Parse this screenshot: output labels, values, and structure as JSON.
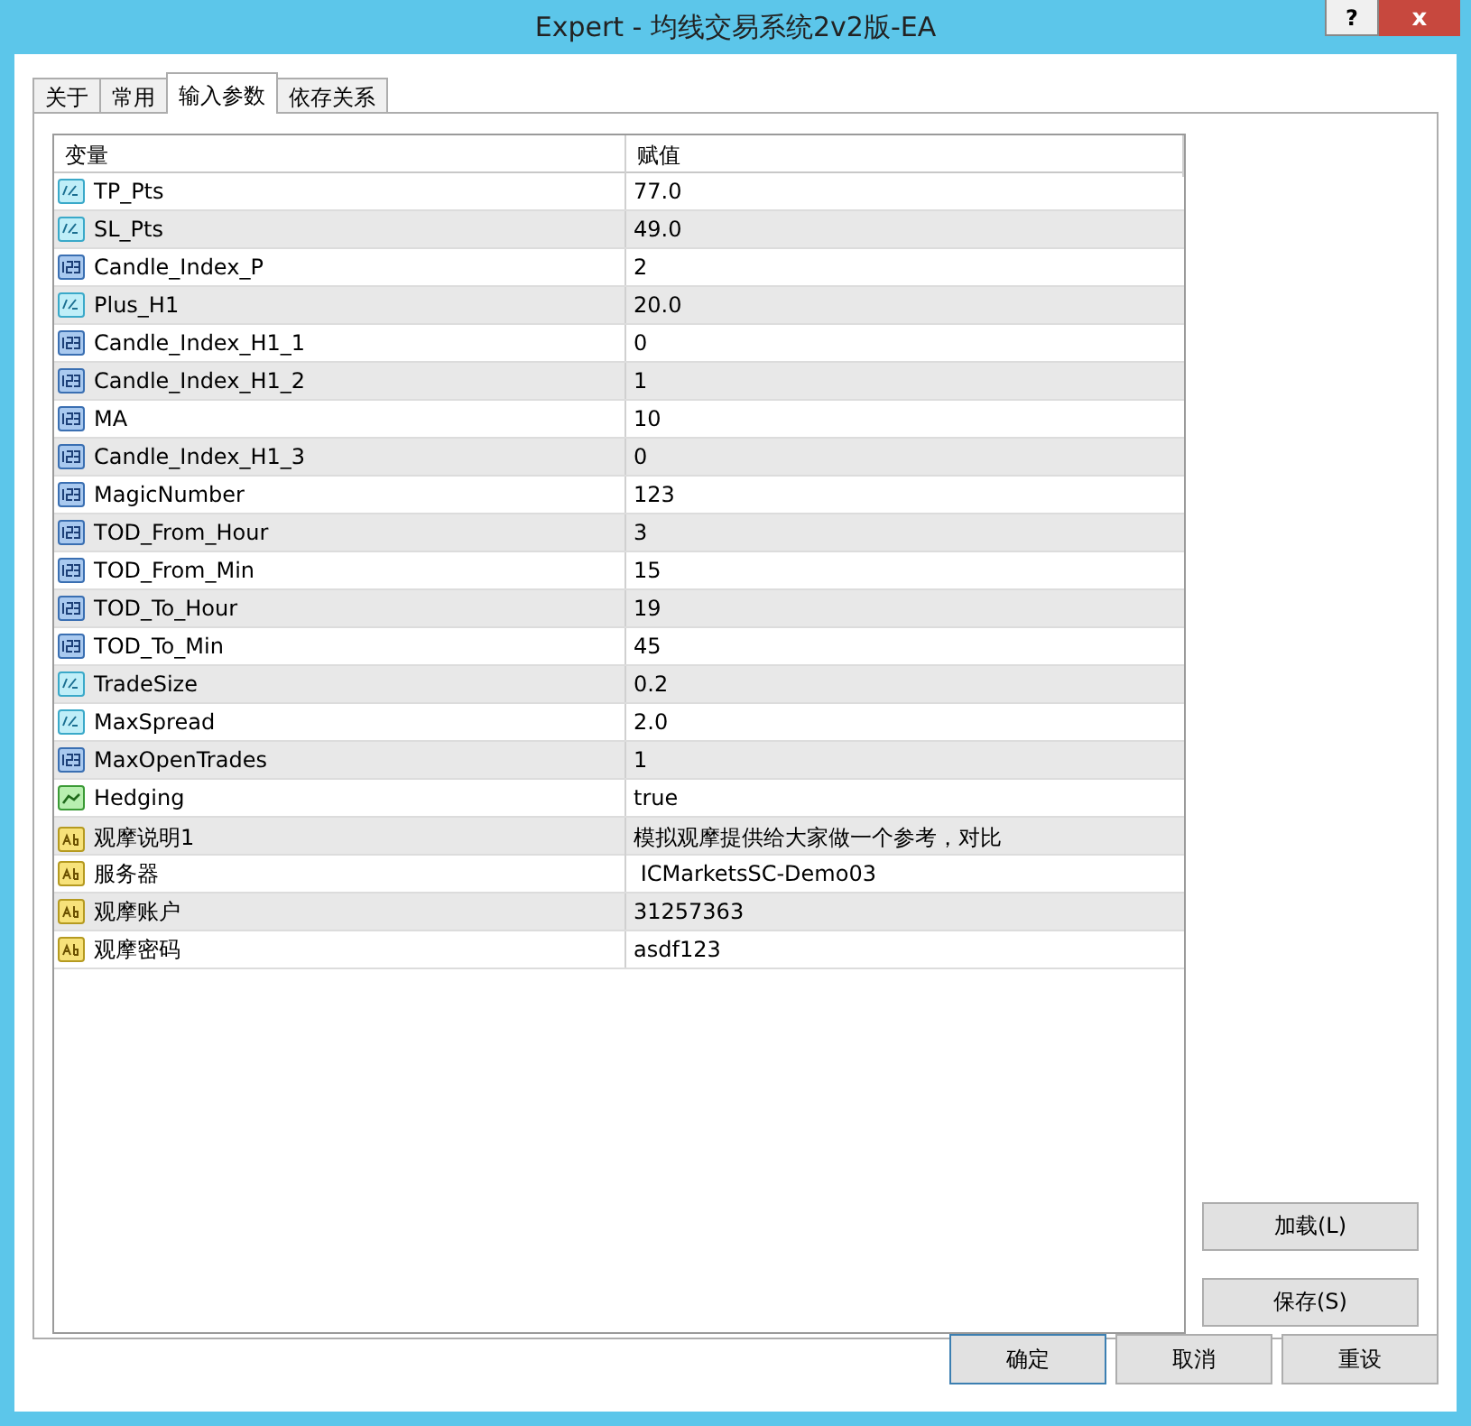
{
  "window": {
    "title": "Expert - 均线交易系统2v2版-EA",
    "help_button": "?",
    "close_button": "x"
  },
  "tabs": [
    {
      "label": "关于",
      "selected": false
    },
    {
      "label": "常用",
      "selected": false
    },
    {
      "label": "输入参数",
      "selected": true
    },
    {
      "label": "依存关系",
      "selected": false
    }
  ],
  "table": {
    "columns": [
      "变量",
      "赋值"
    ],
    "rows": [
      {
        "kind": "double",
        "name": "TP_Pts",
        "value": "77.0"
      },
      {
        "kind": "double",
        "name": "SL_Pts",
        "value": "49.0"
      },
      {
        "kind": "int",
        "name": "Candle_Index_P",
        "value": "2"
      },
      {
        "kind": "double",
        "name": "Plus_H1",
        "value": "20.0"
      },
      {
        "kind": "int",
        "name": "Candle_Index_H1_1",
        "value": "0"
      },
      {
        "kind": "int",
        "name": "Candle_Index_H1_2",
        "value": "1"
      },
      {
        "kind": "int",
        "name": "MA",
        "value": "10"
      },
      {
        "kind": "int",
        "name": "Candle_Index_H1_3",
        "value": "0"
      },
      {
        "kind": "int",
        "name": "MagicNumber",
        "value": "123"
      },
      {
        "kind": "int",
        "name": "TOD_From_Hour",
        "value": "3"
      },
      {
        "kind": "int",
        "name": "TOD_From_Min",
        "value": "15"
      },
      {
        "kind": "int",
        "name": "TOD_To_Hour",
        "value": "19"
      },
      {
        "kind": "int",
        "name": "TOD_To_Min",
        "value": "45"
      },
      {
        "kind": "double",
        "name": "TradeSize",
        "value": "0.2"
      },
      {
        "kind": "double",
        "name": "MaxSpread",
        "value": "2.0"
      },
      {
        "kind": "int",
        "name": "MaxOpenTrades",
        "value": "1"
      },
      {
        "kind": "bool",
        "name": "Hedging",
        "value": "true"
      },
      {
        "kind": "string",
        "name": "观摩说明1",
        "value": "模拟观摩提供给大家做一个参考，对比"
      },
      {
        "kind": "string",
        "name": "服务器",
        "value": " ICMarketsSC-Demo03"
      },
      {
        "kind": "string",
        "name": "观摩账户",
        "value": "31257363"
      },
      {
        "kind": "string",
        "name": "观摩密码",
        "value": "asdf123"
      }
    ]
  },
  "side_buttons": [
    "加载(L)",
    "保存(S)"
  ],
  "buttons": [
    {
      "label": "确定",
      "default": true
    },
    {
      "label": "取消",
      "default": false
    },
    {
      "label": "重设",
      "default": false
    }
  ]
}
